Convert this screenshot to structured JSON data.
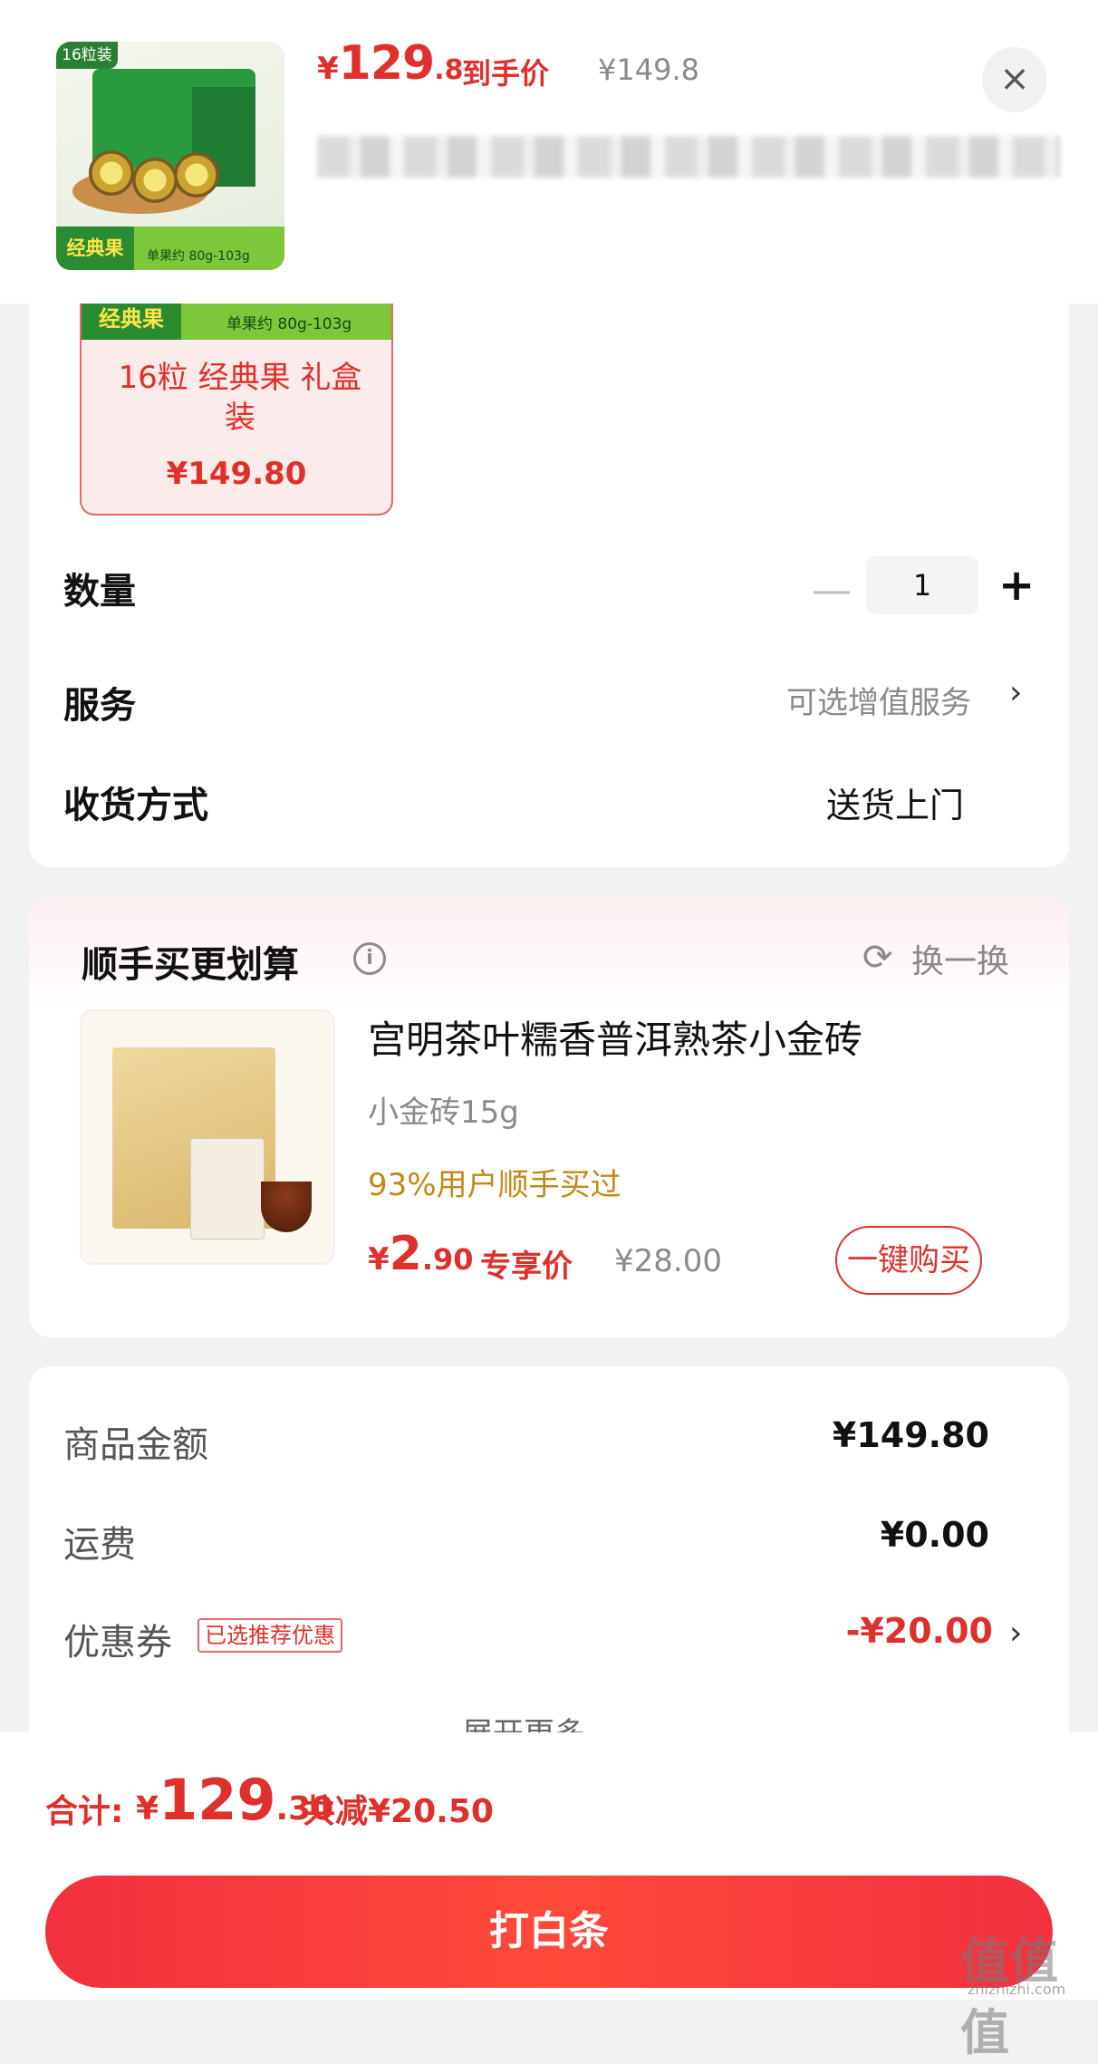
{
  "header": {
    "thumb_badge": "16粒装",
    "thumb_band_label": "经典果",
    "thumb_weight": "单果约 80g-103g",
    "price_yen": "¥",
    "price_int": "129",
    "price_dec": ".8",
    "price_tag": "到手价",
    "price_orig": "¥149.8",
    "close_icon": "×"
  },
  "sku": {
    "strip_label": "经典果",
    "strip_weight": "单果约 80g-103g",
    "name": "16粒 经典果 礼盒装",
    "price": "¥149.80"
  },
  "options": {
    "qty_label": "数量",
    "qty_minus": "—",
    "qty_value": "1",
    "qty_plus": "+",
    "service_label": "服务",
    "service_value": "可选增值服务",
    "service_arrow": "›",
    "ship_label": "收货方式",
    "ship_value": "送货上门"
  },
  "addon": {
    "title": "顺手买更划算",
    "info_icon": "i",
    "refresh_icon": "⟳",
    "refresh_label": "换一换",
    "product_name": "宫明茶叶糯香普洱熟茶小金砖",
    "spec": "小金砖15g",
    "bought_pct": "93%用户顺手买过",
    "price_yen": "¥",
    "price_int": "2",
    "price_dec": ".90",
    "price_tag": "专享价",
    "price_orig": "¥28.00",
    "buy_button": "一键购买"
  },
  "summary": {
    "goods_label": "商品金额",
    "goods_value": "¥149.80",
    "freight_label": "运费",
    "freight_value": "¥0.00",
    "coupon_label": "优惠券",
    "coupon_badge": "已选推荐优惠",
    "coupon_value": "-¥20.00",
    "coupon_arrow": "›",
    "more": "展开更多 ⌄"
  },
  "footer": {
    "total_label": "合计:",
    "total_yen": "¥",
    "total_int": "129",
    "total_dec": ".30",
    "total_save": "共减¥20.50",
    "pay_button": "打白条",
    "watermark": "值值值",
    "watermark_url": "zhizhizhi.com"
  },
  "colors": {
    "accent": "#e0302b",
    "gold": "#c48a16",
    "muted": "#8a8a8a"
  }
}
